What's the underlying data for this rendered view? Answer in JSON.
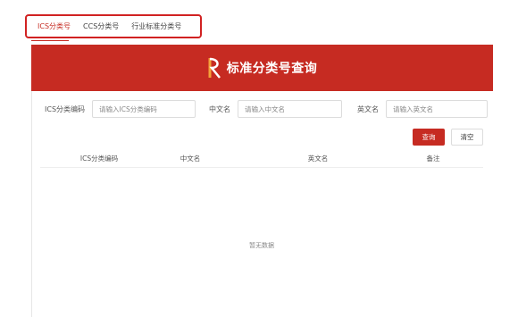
{
  "tabs": [
    {
      "label": "ICS分类号",
      "active": true
    },
    {
      "label": "CCS分类号",
      "active": false
    },
    {
      "label": "行业标准分类号",
      "active": false
    }
  ],
  "banner": {
    "title": "标准分类号查询",
    "logo_icon": "r-logo-icon",
    "background": "#c62b22"
  },
  "search": {
    "ics_label": "ICS分类编码",
    "ics_placeholder": "请输入ICS分类编码",
    "cn_label": "中文名",
    "cn_placeholder": "请输入中文名",
    "en_label": "英文名",
    "en_placeholder": "请输入英文名"
  },
  "buttons": {
    "query": "查询",
    "clear": "清空"
  },
  "table": {
    "columns": [
      "ICS分类编码",
      "中文名",
      "英文名",
      "备注"
    ],
    "rows": [],
    "empty_text": "暂无数据"
  },
  "colors": {
    "accent": "#c62b22",
    "highlight_border": "#d12222"
  }
}
